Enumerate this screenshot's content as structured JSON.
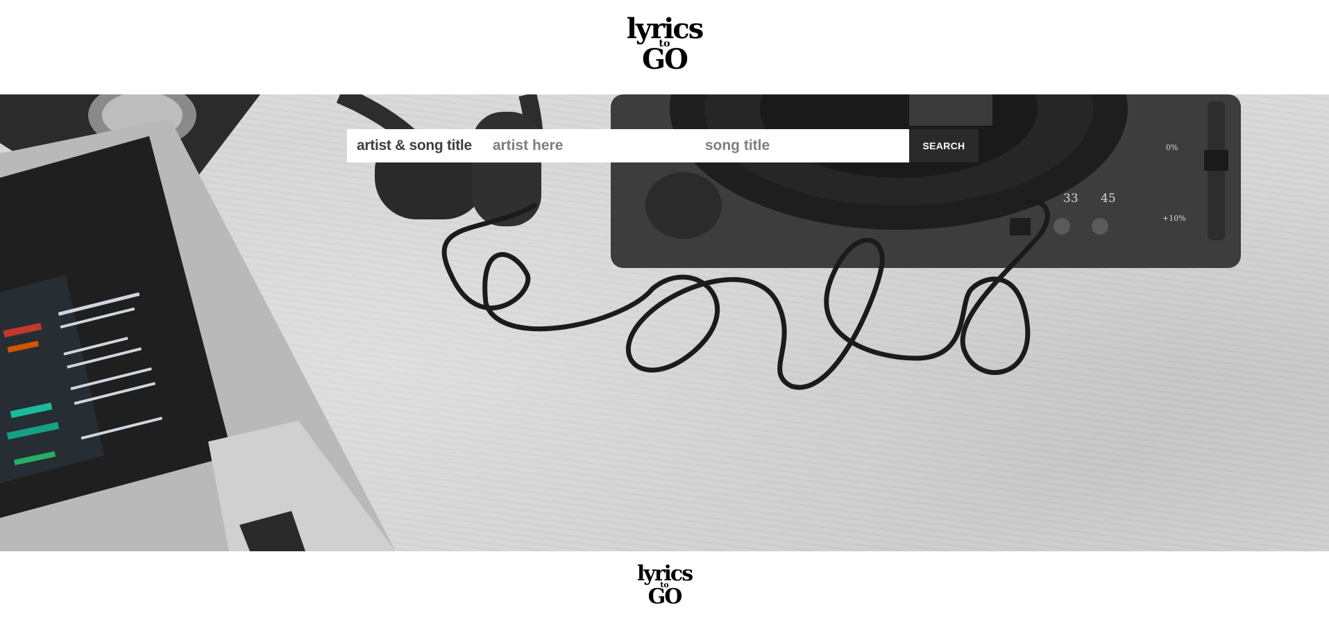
{
  "header": {
    "logo": {
      "line1": "lyrics",
      "line2": "to",
      "line3": "GO"
    }
  },
  "search": {
    "label": "artist & song title",
    "artist_placeholder": "artist here",
    "song_placeholder": "song title",
    "button_label": "SEARCH"
  },
  "hero": {
    "turntable_speed_33": "33",
    "turntable_speed_45": "45",
    "pitch_zero": "0%",
    "pitch_minus": "+10%"
  },
  "footer": {
    "logo": {
      "line1": "lyrics",
      "line2": "to",
      "line3": "GO"
    }
  }
}
